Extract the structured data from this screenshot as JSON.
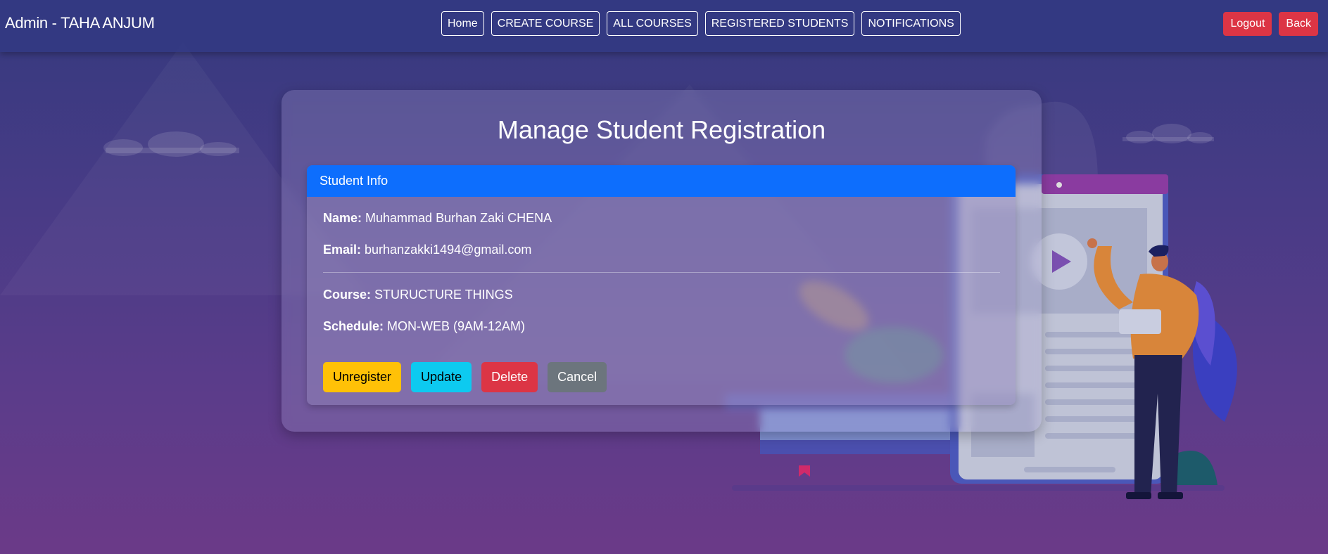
{
  "navbar": {
    "brand": "Admin - TAHA ANJUM",
    "links": [
      "Home",
      "CREATE COURSE",
      "ALL COURSES",
      "REGISTERED STUDENTS",
      "NOTIFICATIONS"
    ],
    "logout_label": "Logout",
    "back_label": "Back"
  },
  "page": {
    "title": "Manage Student Registration"
  },
  "student_card": {
    "header": "Student Info",
    "name_label": "Name:",
    "name_value": "Muhammad Burhan Zaki CHENA",
    "email_label": "Email:",
    "email_value": "burhanzakki1494@gmail.com",
    "course_label": "Course:",
    "course_value": "STURUCTURE THINGS",
    "schedule_label": "Schedule:",
    "schedule_value": "MON-WEB (9AM-12AM)"
  },
  "actions": {
    "unregister_label": "Unregister",
    "update_label": "Update",
    "delete_label": "Delete",
    "cancel_label": "Cancel"
  },
  "colors": {
    "primary": "#0d6efd",
    "danger": "#dc3545",
    "warning": "#ffc107",
    "info": "#0dcaf0",
    "secondary": "#6c757d"
  }
}
